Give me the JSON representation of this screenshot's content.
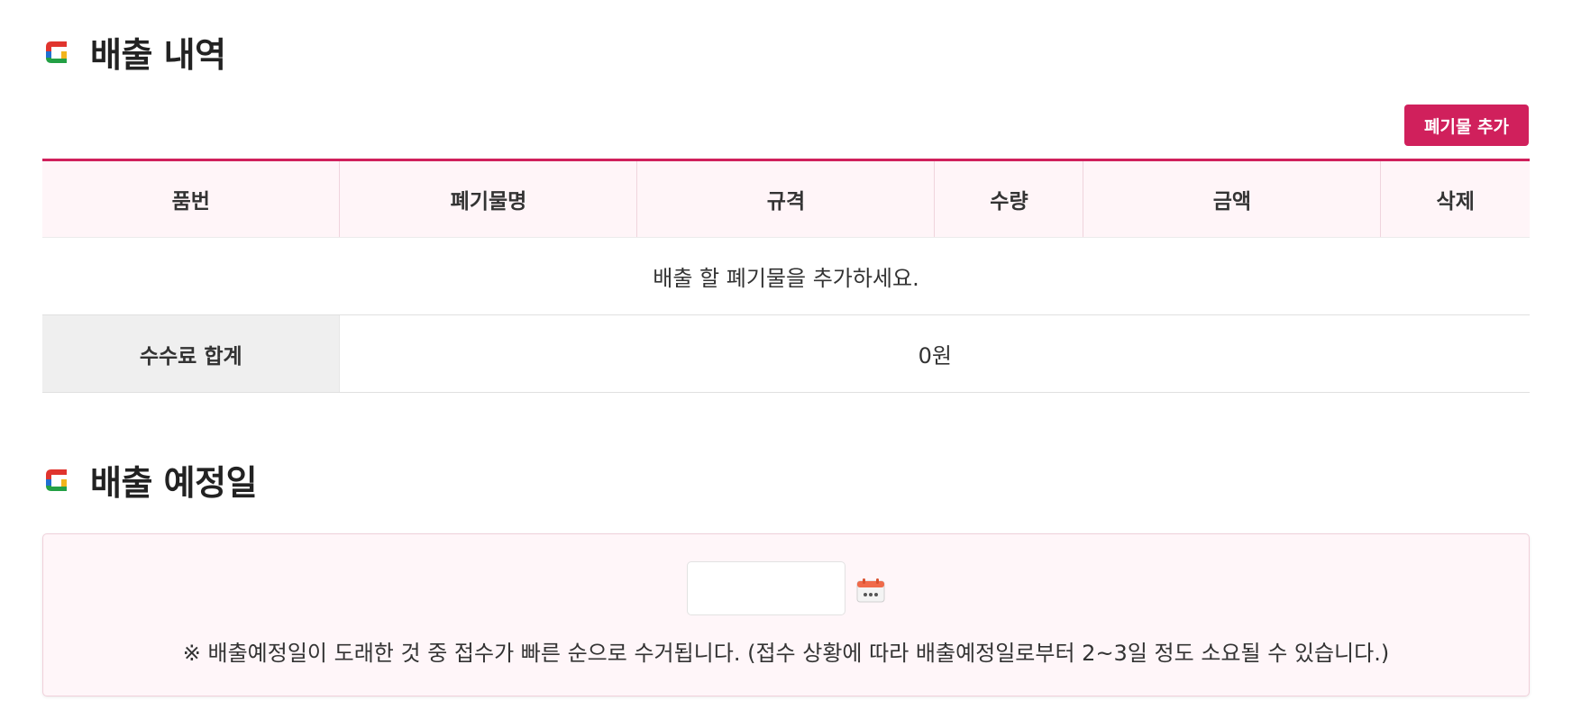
{
  "sections": {
    "discharge_history": {
      "title": "배출 내역"
    },
    "schedule": {
      "title": "배출 예정일"
    }
  },
  "toolbar": {
    "add_waste_label": "폐기물 추가"
  },
  "table": {
    "headers": [
      "품번",
      "폐기물명",
      "규격",
      "수량",
      "금액",
      "삭제"
    ],
    "empty_message": "배출 할 폐기물을 추가하세요.",
    "fee_total_label": "수수료 합계",
    "fee_total_value": "0원"
  },
  "date_picker": {
    "value": "",
    "icon": "calendar-icon",
    "note": "※ 배출예정일이 도래한 것 중 접수가 빠른 순으로 수거됩니다. (접수 상황에 따라 배출예정일로부터 2~3일 정도 소요될 수 있습니다.)"
  },
  "colors": {
    "accent": "#d0205c",
    "header_bg": "#fff5f8",
    "fee_label_bg": "#efefef",
    "logo_blue": "#1f6fd1",
    "logo_red": "#e0342e",
    "logo_yellow": "#f2b51c",
    "logo_green": "#23a045"
  }
}
